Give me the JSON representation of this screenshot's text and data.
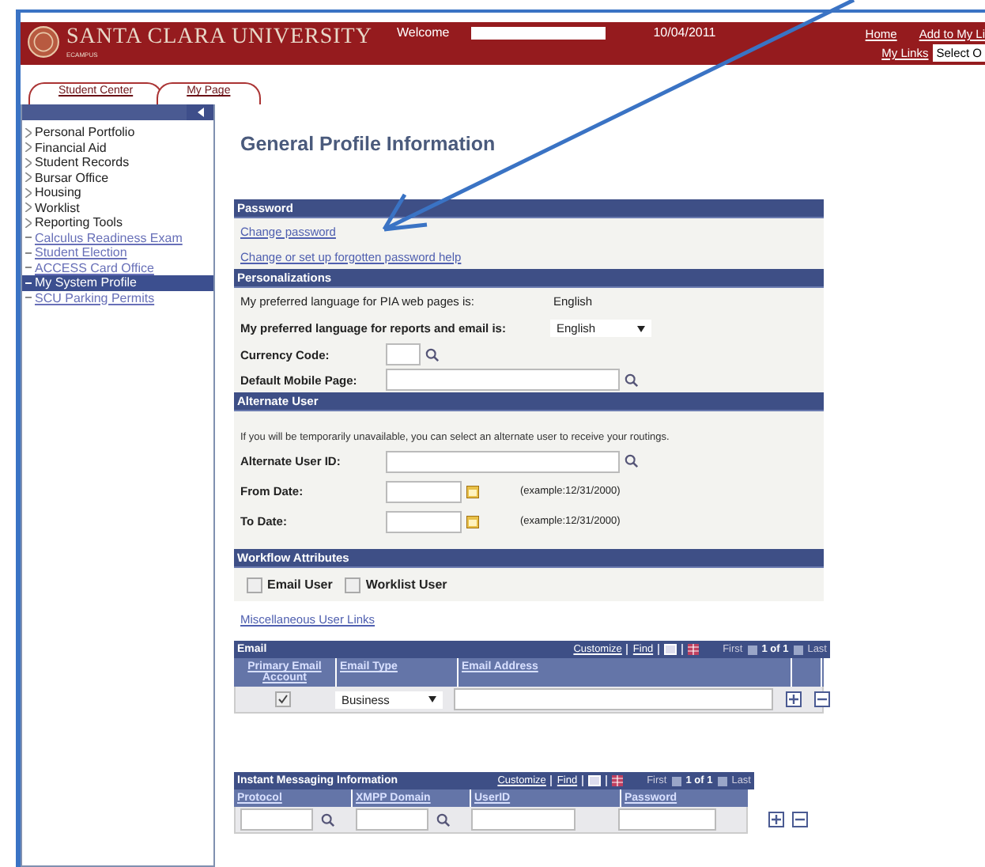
{
  "header": {
    "logo_title": "SANTA CLARA UNIVERSITY",
    "logo_subtitle": "ECAMPUS",
    "welcome": "Welcome",
    "date": "10/04/2011",
    "links": [
      "Home",
      "Add to My Li"
    ],
    "my_links": "My Links",
    "select_value": "Select O"
  },
  "tabs": [
    {
      "label": "Student Center",
      "selected": false
    },
    {
      "label": "My Page",
      "selected": false
    }
  ],
  "sidebar": {
    "items": [
      {
        "label": "Personal Portfolio",
        "kind": "folder",
        "selected": false
      },
      {
        "label": "Financial Aid",
        "kind": "folder",
        "selected": false
      },
      {
        "label": "Student Records",
        "kind": "folder",
        "selected": false
      },
      {
        "label": "Bursar Office",
        "kind": "folder",
        "selected": false
      },
      {
        "label": "Housing",
        "kind": "folder",
        "selected": false
      },
      {
        "label": "Worklist",
        "kind": "folder",
        "selected": false
      },
      {
        "label": "Reporting Tools",
        "kind": "folder",
        "selected": false
      },
      {
        "label": "Calculus Readiness Exam",
        "kind": "link",
        "selected": false
      },
      {
        "label": "Student Election",
        "kind": "link",
        "selected": false
      },
      {
        "label": "ACCESS Card Office",
        "kind": "link",
        "selected": false
      },
      {
        "label": "My System Profile",
        "kind": "link",
        "selected": true
      },
      {
        "label": "SCU Parking Permits",
        "kind": "link",
        "selected": false
      }
    ]
  },
  "page_title": "General Profile Information",
  "password": {
    "heading": "Password",
    "links": [
      "Change password",
      "Change or set up forgotten password help"
    ]
  },
  "personalizations": {
    "heading": "Personalizations",
    "pia_label": "My preferred language for PIA web pages is:",
    "pia_value": "English",
    "report_label": "My preferred language for reports and email is:",
    "report_value": "English",
    "currency_label": "Currency Code:",
    "mobile_label": "Default Mobile Page:"
  },
  "alternate_user": {
    "heading": "Alternate User",
    "note": "If you will be temporarily unavailable, you can select an alternate user to receive your routings.",
    "id_label": "Alternate User ID:",
    "from_label": "From Date:",
    "to_label": "To Date:",
    "from_example": "(example:12/31/2000)",
    "to_example": "(example:12/31/2000)"
  },
  "workflow": {
    "heading": "Workflow Attributes",
    "options": [
      {
        "label": "Email User",
        "checked": false
      },
      {
        "label": "Worklist User",
        "checked": false
      }
    ]
  },
  "misc_link": "Miscellaneous User Links",
  "email": {
    "title": "Email",
    "customize": "Customize",
    "find": "Find",
    "nav_first": "First",
    "nav_count": "1 of 1",
    "nav_last": "Last",
    "columns": [
      "Primary Email Account",
      "Email Type",
      "Email Address"
    ],
    "rows": [
      {
        "primary": true,
        "type": "Business"
      }
    ]
  },
  "im": {
    "title": "Instant Messaging Information",
    "customize": "Customize",
    "find": "Find",
    "nav_first": "First",
    "nav_count": "1 of 1",
    "nav_last": "Last",
    "columns": [
      "Protocol",
      "XMPP Domain",
      "UserID",
      "Password"
    ]
  }
}
